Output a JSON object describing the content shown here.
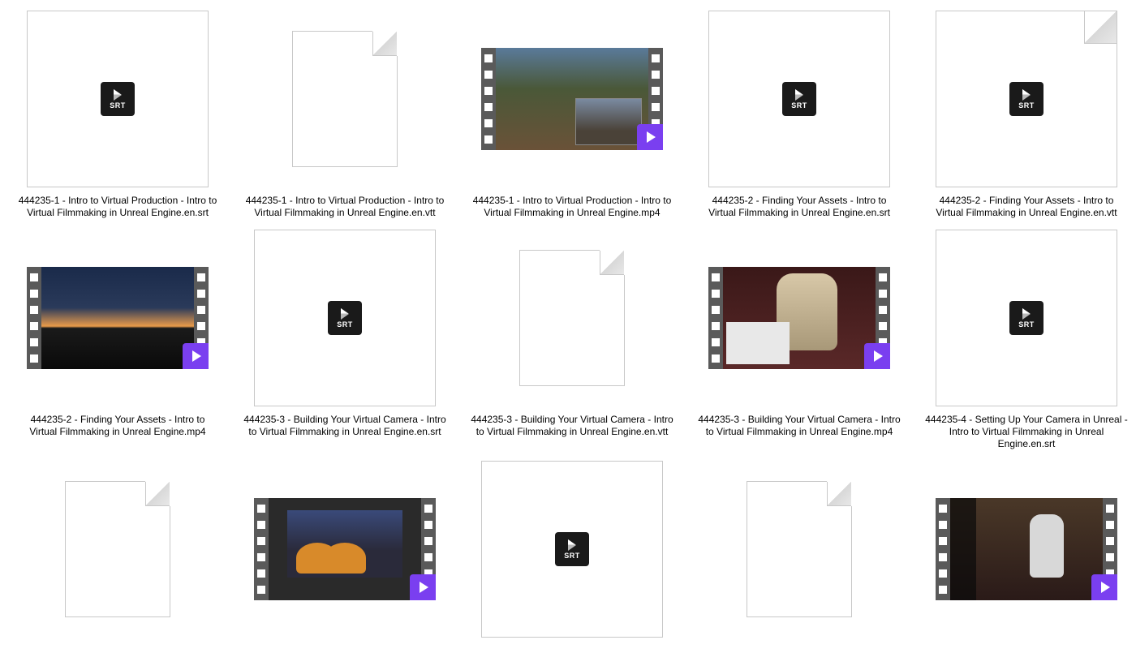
{
  "srt_badge_text": "SRT",
  "files": [
    {
      "type": "srt",
      "label": "444235-1 - Intro to Virtual Production - Intro to Virtual Filmmaking in Unreal Engine.en.srt"
    },
    {
      "type": "vtt",
      "label": "444235-1 - Intro to Virtual Production - Intro to Virtual Filmmaking in Unreal Engine.en.vtt",
      "small": true
    },
    {
      "type": "video",
      "label": "444235-1 - Intro to Virtual Production - Intro to Virtual Filmmaking in Unreal Engine.mp4",
      "vclass": "vc1"
    },
    {
      "type": "srt",
      "label": "444235-2 - Finding Your Assets - Intro to Virtual Filmmaking in Unreal Engine.en.srt"
    },
    {
      "type": "vtt",
      "label": "444235-2 - Finding Your Assets - Intro to Virtual Filmmaking in Unreal Engine.en.vtt"
    },
    {
      "type": "video",
      "label": "444235-2 - Finding Your Assets - Intro to Virtual Filmmaking in Unreal Engine.mp4",
      "vclass": "vc2"
    },
    {
      "type": "srt",
      "label": "444235-3 - Building Your Virtual Camera - Intro to Virtual Filmmaking in Unreal Engine.en.srt"
    },
    {
      "type": "vtt",
      "label": "444235-3 - Building Your Virtual Camera - Intro to Virtual Filmmaking in Unreal Engine.en.vtt",
      "small": true
    },
    {
      "type": "video",
      "label": "444235-3 - Building Your Virtual Camera - Intro to Virtual Filmmaking in Unreal Engine.mp4",
      "vclass": "vc3"
    },
    {
      "type": "srt",
      "label": "444235-4 - Setting Up Your Camera in Unreal - Intro to Virtual Filmmaking in Unreal Engine.en.srt"
    },
    {
      "type": "vtt",
      "label": "",
      "small": true
    },
    {
      "type": "video",
      "label": "",
      "vclass": "vc4"
    },
    {
      "type": "srt",
      "label": ""
    },
    {
      "type": "vtt",
      "label": "",
      "small": true
    },
    {
      "type": "video",
      "label": "",
      "vclass": "vc5"
    }
  ]
}
